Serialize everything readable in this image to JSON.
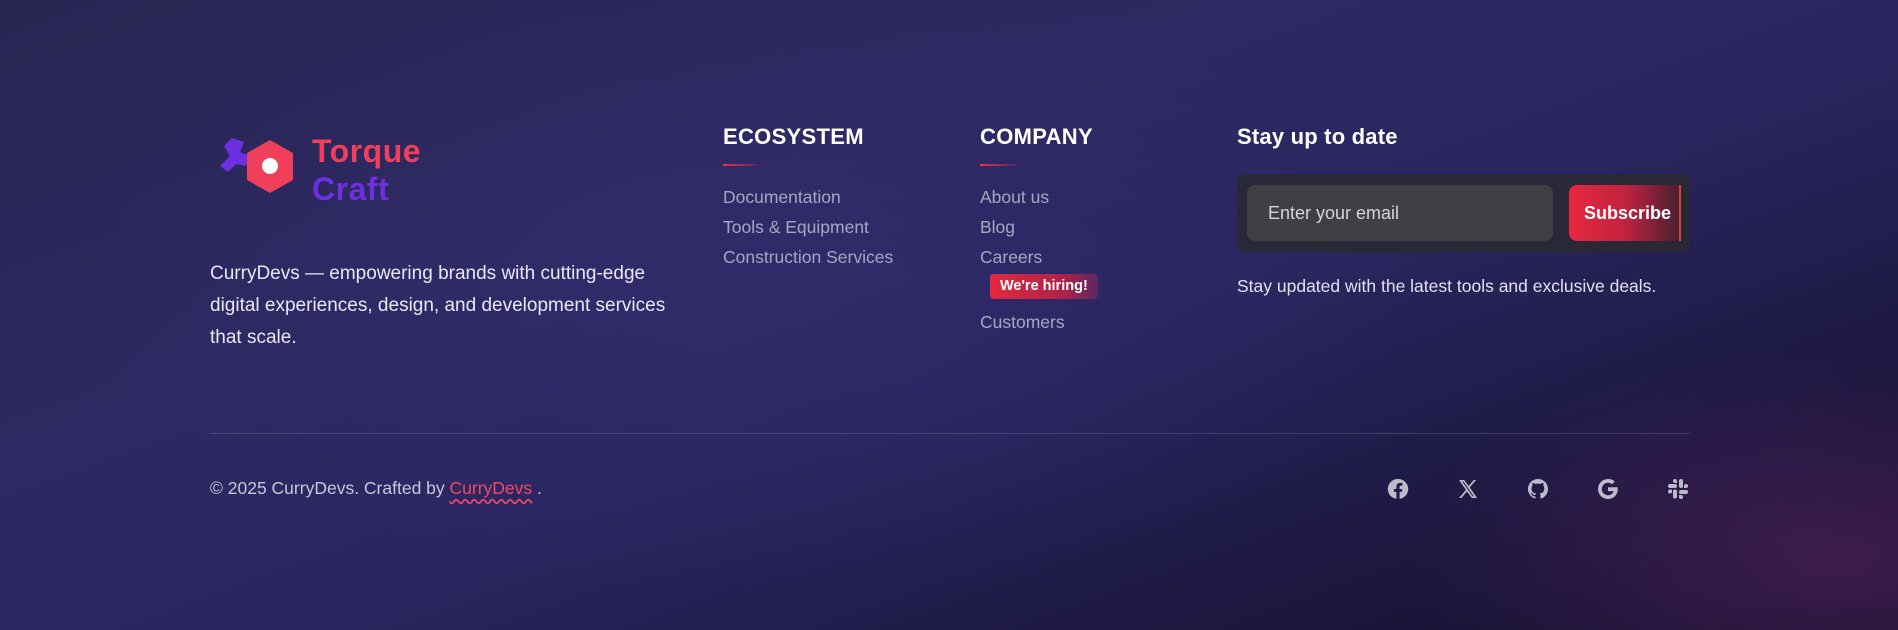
{
  "brand": {
    "logo_word1": "Torque",
    "logo_word2": "Craft",
    "description": "CurryDevs — empowering brands with cutting-edge digital experiences, design, and development services that scale."
  },
  "ecosystem": {
    "heading": "ECOSYSTEM",
    "links": [
      "Documentation",
      "Tools & Equipment",
      "Construction Services"
    ]
  },
  "company": {
    "heading": "COMPANY",
    "links": [
      "About us",
      "Blog",
      "Careers",
      "Customers"
    ],
    "hiring_badge": "We're hiring!"
  },
  "newsletter": {
    "heading": "Stay up to date",
    "email_placeholder": "Enter your email",
    "subscribe_label": "Subscribe",
    "note": "Stay updated with the latest tools and exclusive deals."
  },
  "bottom": {
    "copyright_prefix": "© 2025 CurryDevs. Crafted by ",
    "credit_link": "CurryDevs",
    "copyright_suffix": " .",
    "socials": [
      "facebook-icon",
      "x-icon",
      "github-icon",
      "google-icon",
      "slack-icon"
    ]
  },
  "colors": {
    "accent_red": "#ef3f5a",
    "accent_purple": "#6d2fe0",
    "background_dark": "#1c1840"
  }
}
